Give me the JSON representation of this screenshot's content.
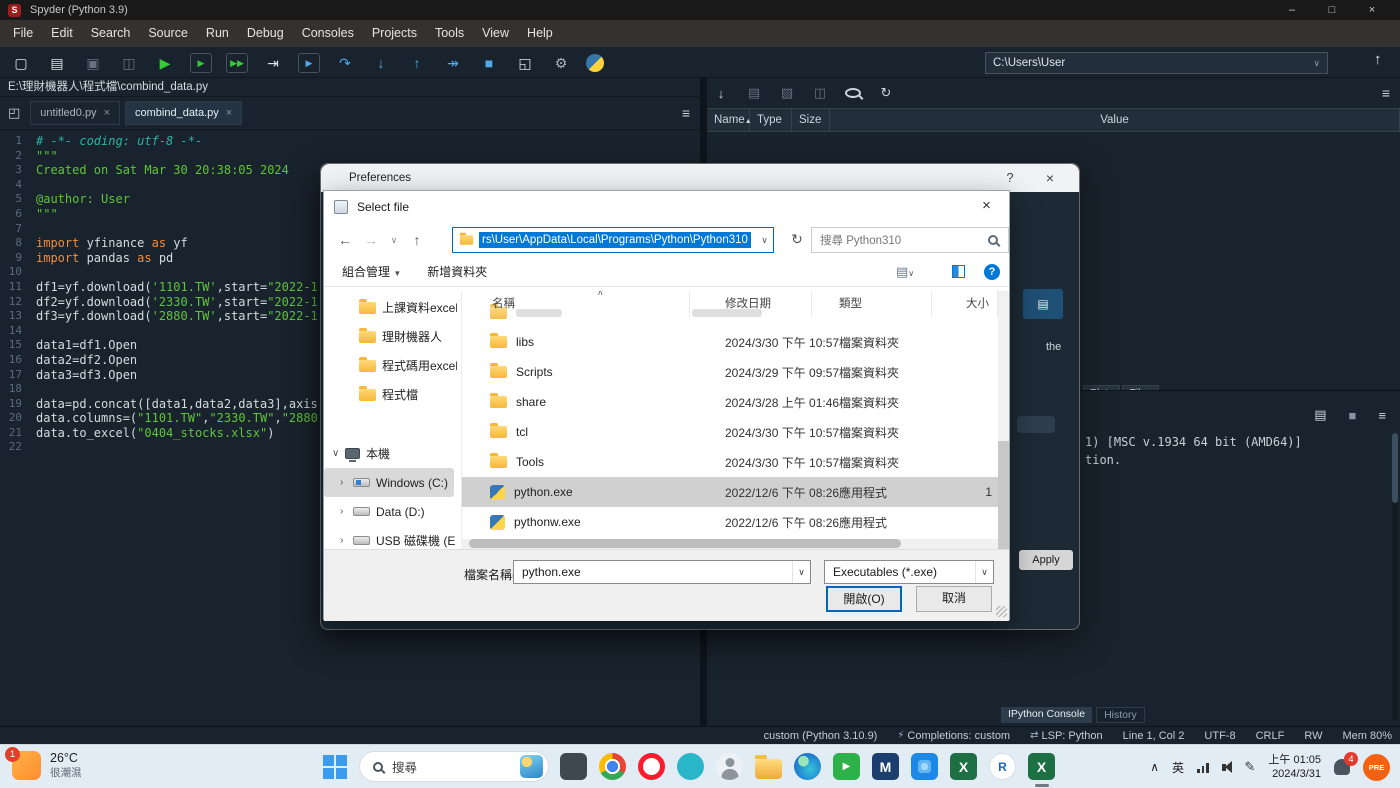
{
  "titlebar": {
    "logo": "S",
    "title": "Spyder (Python 3.9)",
    "min": "–",
    "max": "□",
    "close": "×"
  },
  "menu": {
    "items": [
      "File",
      "Edit",
      "Search",
      "Source",
      "Run",
      "Debug",
      "Consoles",
      "Projects",
      "Tools",
      "View",
      "Help"
    ]
  },
  "toolbar": {
    "icons": [
      {
        "n": "new-file",
        "g": "▢",
        "c": "#dbe1e7"
      },
      {
        "n": "open-file",
        "g": "▤",
        "c": "#dbe1e7"
      },
      {
        "n": "save-file",
        "g": "▣",
        "c": "#66727e"
      },
      {
        "n": "save-all",
        "g": "◫",
        "c": "#66727e"
      },
      {
        "n": "run-file",
        "g": "▶",
        "c": "#37c837"
      },
      {
        "n": "run-cell",
        "g": "▶",
        "c": "#37c837",
        "cls": "boxed"
      },
      {
        "n": "run-cell-advance",
        "g": "▶▶",
        "c": "#37c837",
        "cls": "boxed"
      },
      {
        "n": "run-selection",
        "g": "⇥",
        "c": "#dbe1e7"
      },
      {
        "n": "debug-file",
        "g": "▶",
        "c": "#53a8e8",
        "cls": "boxed"
      },
      {
        "n": "step-over",
        "g": "↷",
        "c": "#53a8e8"
      },
      {
        "n": "step-into",
        "g": "↓",
        "c": "#53a8e8"
      },
      {
        "n": "step-out",
        "g": "↑",
        "c": "#53a8e8"
      },
      {
        "n": "continue-execution",
        "g": "↠",
        "c": "#53a8e8"
      },
      {
        "n": "stop-debug",
        "g": "■",
        "c": "#53a8e8"
      },
      {
        "n": "maximize-pane",
        "g": "◱",
        "c": "#dbe1e7"
      },
      {
        "n": "preferences",
        "g": "⚙",
        "c": "#aab4bd"
      },
      {
        "n": "python-env",
        "cls": "pyball"
      }
    ],
    "path_combo": "C:\\Users\\User",
    "combo_caret": "∨",
    "up": "↑"
  },
  "editor": {
    "path": "E:\\理財機器人\\程式檔\\combind_data.py",
    "pane_icon": "◰",
    "menu": "≡",
    "close_glyph": "×",
    "tabs": [
      {
        "label": "untitled0.py"
      },
      {
        "label": "combind_data.py",
        "active": true
      }
    ],
    "lines": [
      {
        "n": 1,
        "t": [
          [
            "c",
            "# -*- coding: utf-8 -*-"
          ]
        ]
      },
      {
        "n": 2,
        "t": [
          [
            "s",
            "\"\"\""
          ]
        ]
      },
      {
        "n": 3,
        "t": [
          [
            "s",
            "Created on Sat Mar 30 20:38:05 2024"
          ]
        ]
      },
      {
        "n": 4,
        "t": []
      },
      {
        "n": 5,
        "t": [
          [
            "s",
            "@author: User"
          ]
        ]
      },
      {
        "n": 6,
        "t": [
          [
            "s",
            "\"\"\""
          ]
        ]
      },
      {
        "n": 7,
        "t": []
      },
      {
        "n": 8,
        "t": [
          [
            "k",
            "import"
          ],
          [
            "p",
            " yfinance "
          ],
          [
            "k",
            "as"
          ],
          [
            "p",
            " yf"
          ]
        ]
      },
      {
        "n": 9,
        "t": [
          [
            "k",
            "import"
          ],
          [
            "p",
            " pandas "
          ],
          [
            "k",
            "as"
          ],
          [
            "p",
            " pd"
          ]
        ]
      },
      {
        "n": 10,
        "t": []
      },
      {
        "n": 11,
        "t": [
          [
            "p",
            "df1=yf.download("
          ],
          [
            "s",
            "'1101.TW'"
          ],
          [
            "p",
            ",start="
          ],
          [
            "s",
            "\"2022-1"
          ]
        ]
      },
      {
        "n": 12,
        "t": [
          [
            "p",
            "df2=yf.download("
          ],
          [
            "s",
            "'2330.TW'"
          ],
          [
            "p",
            ",start="
          ],
          [
            "s",
            "\"2022-1"
          ]
        ]
      },
      {
        "n": 13,
        "t": [
          [
            "p",
            "df3=yf.download("
          ],
          [
            "s",
            "'2880.TW'"
          ],
          [
            "p",
            ",start="
          ],
          [
            "s",
            "\"2022-1"
          ]
        ]
      },
      {
        "n": 14,
        "t": []
      },
      {
        "n": 15,
        "t": [
          [
            "p",
            "data1=df1.Open"
          ]
        ]
      },
      {
        "n": 16,
        "t": [
          [
            "p",
            "data2=df2.Open"
          ]
        ]
      },
      {
        "n": 17,
        "t": [
          [
            "p",
            "data3=df3.Open"
          ]
        ]
      },
      {
        "n": 18,
        "t": []
      },
      {
        "n": 19,
        "t": [
          [
            "p",
            "data=pd.concat([data1,data2,data3],axis"
          ]
        ]
      },
      {
        "n": 20,
        "t": [
          [
            "p",
            "data.columns=("
          ],
          [
            "s",
            "\"1101.TW\""
          ],
          [
            "p",
            ","
          ],
          [
            "s",
            "\"2330.TW\""
          ],
          [
            "p",
            ","
          ],
          [
            "s",
            "\"2880"
          ]
        ]
      },
      {
        "n": 21,
        "t": [
          [
            "p",
            "data.to_excel("
          ],
          [
            "s",
            "\"0404_stocks.xlsx\""
          ],
          [
            "p",
            ")"
          ]
        ]
      },
      {
        "n": 22,
        "t": []
      }
    ]
  },
  "varexp": {
    "icons": [
      {
        "n": "import-data",
        "g": "↓",
        "c": "#cdd5dc"
      },
      {
        "n": "save-data",
        "g": "▤",
        "c": "#66727e"
      },
      {
        "n": "save-data-as",
        "g": "▧",
        "c": "#66727e"
      },
      {
        "n": "copy-data",
        "g": "◫",
        "c": "#66727e"
      },
      {
        "n": "search-variable",
        "c": "#cdd5dc",
        "cls": "mag"
      },
      {
        "n": "refresh-variables",
        "g": "↻",
        "c": "#cdd5dc"
      }
    ],
    "columns": [
      "Name",
      "Type",
      "Size",
      "Value"
    ],
    "sort": "▲",
    "menu": "≡"
  },
  "panetabs": {
    "plots": "Plots",
    "files": "Files"
  },
  "console": {
    "icons": [
      {
        "n": "console-environment",
        "g": "▤",
        "c": "#cdd5dc"
      },
      {
        "n": "stop-kernel",
        "g": "■",
        "c": "#8795a1"
      },
      {
        "n": "console-options-menu",
        "g": "≡",
        "c": "#cdd5dc"
      }
    ],
    "lines": [
      "1) [MSC v.1934 64 bit (AMD64)]",
      "tion."
    ],
    "tabs": [
      {
        "l": "IPython Console",
        "a": true
      },
      {
        "l": "History"
      }
    ]
  },
  "statusbar": {
    "items": [
      {
        "t": "custom (Python 3.10.9)"
      },
      {
        "i": "⚡",
        "t": "Completions: custom"
      },
      {
        "i": "⇄",
        "t": "LSP: Python"
      },
      {
        "t": "Line 1, Col 2"
      },
      {
        "t": "UTF-8"
      },
      {
        "t": "CRLF"
      },
      {
        "t": "RW"
      },
      {
        "t": "Mem 80%"
      }
    ]
  },
  "preferences": {
    "title": "Preferences",
    "help": "?",
    "close": "×",
    "icon_glyph": "▤",
    "fragment": "the",
    "apply": "Apply"
  },
  "filedialog": {
    "title": "Select file",
    "close": "×",
    "nav": {
      "back": "←",
      "forward": "→",
      "recent": "∨",
      "up": "↑",
      "refresh": "↻",
      "address_caret": "∨"
    },
    "address": "rs\\User\\AppData\\Local\\Programs\\Python\\Python310",
    "search": "搜尋 Python310",
    "organize": "組合管理",
    "organize_caret": "▼",
    "new_folder": "新增資料夾",
    "views_icon": "▤",
    "views_caret": "∨",
    "help": "?",
    "columns": [
      "名稱",
      "修改日期",
      "類型",
      "大小"
    ],
    "sort_caret": "∧",
    "tree": [
      {
        "i": "folder",
        "l": "上課資料excel",
        "ind": 22
      },
      {
        "i": "folder",
        "l": "理財機器人",
        "ind": 22
      },
      {
        "i": "folder",
        "l": "程式碼用excel",
        "ind": 22
      },
      {
        "i": "folder",
        "l": "程式檔",
        "ind": 22
      },
      {
        "gap": true
      },
      {
        "e": "∨",
        "i": "pc",
        "l": "本機",
        "ind": 8
      },
      {
        "e": "›",
        "i": "windrive",
        "l": "Windows (C:)",
        "ind": 16,
        "sel": true
      },
      {
        "e": "›",
        "i": "drive",
        "l": "Data (D:)",
        "ind": 16
      },
      {
        "e": "›",
        "i": "usb",
        "l": "USB 磁碟機 (E",
        "ind": 16
      }
    ],
    "rows": [
      {
        "i": "folder",
        "n": "libs",
        "d": "2024/3/30 下午 10:57",
        "t": "檔案資料夾",
        "s": ""
      },
      {
        "i": "folder",
        "n": "Scripts",
        "d": "2024/3/29 下午 09:57",
        "t": "檔案資料夾",
        "s": ""
      },
      {
        "i": "folder",
        "n": "share",
        "d": "2024/3/28 上午 01:46",
        "t": "檔案資料夾",
        "s": ""
      },
      {
        "i": "folder",
        "n": "tcl",
        "d": "2024/3/30 下午 10:57",
        "t": "檔案資料夾",
        "s": ""
      },
      {
        "i": "folder",
        "n": "Tools",
        "d": "2024/3/30 下午 10:57",
        "t": "檔案資料夾",
        "s": ""
      },
      {
        "i": "python",
        "n": "python.exe",
        "d": "2022/12/6 下午 08:26",
        "t": "應用程式",
        "s": "1",
        "sel": true
      },
      {
        "i": "python",
        "n": "pythonw.exe",
        "d": "2022/12/6 下午 08:26",
        "t": "應用程式",
        "s": ""
      }
    ],
    "filename_label": "檔案名稱(N):",
    "filename_value": "python.exe",
    "filetype_value": "Executables (*.exe)",
    "combo_caret": "∨",
    "open_label": "開啟(O)",
    "cancel_label": "取消"
  },
  "taskbar": {
    "weather": {
      "badge": "1",
      "temp": "26°C",
      "desc": "很潮濕"
    },
    "search_label": "搜尋",
    "apps": [
      {
        "n": "window-app",
        "cls": "app-dark"
      },
      {
        "n": "chrome",
        "cls": "app-chrome"
      },
      {
        "n": "opera",
        "cls": "app-opera"
      },
      {
        "n": "teal-app",
        "cls": "app-teal"
      },
      {
        "n": "people",
        "cls": "app-people"
      },
      {
        "n": "file-explorer",
        "cls": "app-folder"
      },
      {
        "n": "edge",
        "cls": "app-edge"
      },
      {
        "n": "green-app",
        "cls": "app-green",
        "t": "▶"
      },
      {
        "n": "m-app",
        "cls": "app-m",
        "t": "M"
      },
      {
        "n": "photos",
        "cls": "app-photos"
      },
      {
        "n": "excel",
        "cls": "app-excel",
        "t": "X"
      },
      {
        "n": "r-app",
        "cls": "app-r",
        "t": "R"
      },
      {
        "n": "excel-active",
        "cls": "app-excel",
        "t": "X",
        "active": true
      }
    ],
    "tray": {
      "chevron": "∧",
      "lang": "英",
      "pen": "✎",
      "time": "上午 01:05",
      "date": "2024/3/31",
      "badge": "4",
      "pre": "PRE"
    }
  }
}
